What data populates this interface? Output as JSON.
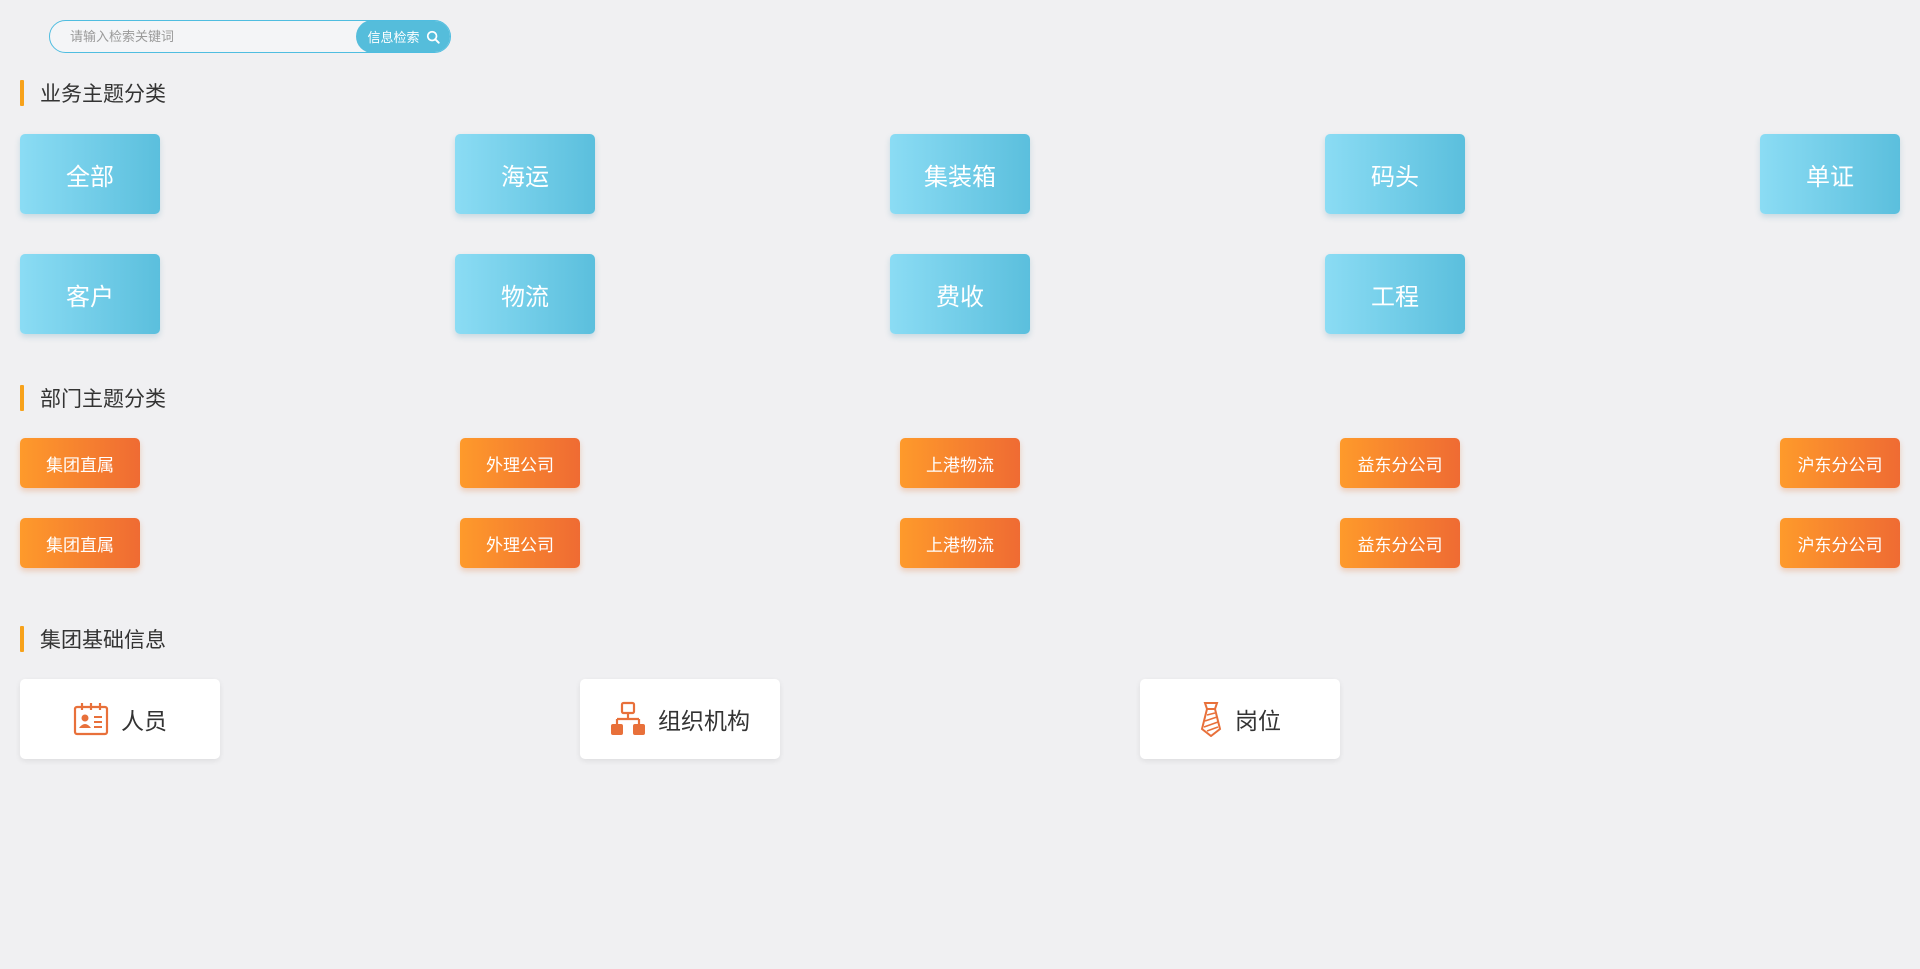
{
  "search": {
    "placeholder": "请输入检索关键词",
    "button_label": "信息检索",
    "icon": "search-icon"
  },
  "colors": {
    "accent_bar": "#f7a21b",
    "topic_blue": "#5bbfdd",
    "dept_orange": "#f47a30",
    "icon_orange": "#e8703a"
  },
  "business_topics": {
    "title": "业务主题分类",
    "items": [
      "全部",
      "海运",
      "集装箱",
      "码头",
      "单证",
      "客户",
      "物流",
      "费收",
      "工程"
    ]
  },
  "department_topics": {
    "title": "部门主题分类",
    "items": [
      "集团直属",
      "外理公司",
      "上港物流",
      "益东分公司",
      "沪东分公司",
      "集团直属",
      "外理公司",
      "上港物流",
      "益东分公司",
      "沪东分公司"
    ]
  },
  "group_info": {
    "title": "集团基础信息",
    "items": [
      {
        "label": "人员",
        "icon": "id-card-icon"
      },
      {
        "label": "组织机构",
        "icon": "org-chart-icon"
      },
      {
        "label": "岗位",
        "icon": "tie-icon"
      }
    ]
  }
}
